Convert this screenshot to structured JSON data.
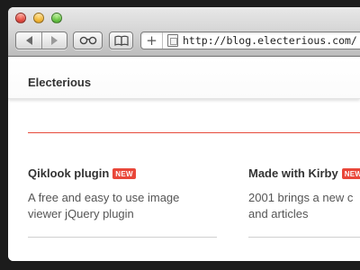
{
  "browser": {
    "url": "http://blog.electerious.com/",
    "new_tab_symbol": "+"
  },
  "site": {
    "title": "Electerious"
  },
  "posts": [
    {
      "title": "Qiklook plugin",
      "badge": "NEW",
      "description_line1": "A free and easy to use image",
      "description_line2": "viewer jQuery plugin"
    },
    {
      "title": "Made with Kirby",
      "badge": "NEW",
      "description_line1": "2001 brings a new c",
      "description_line2": "and articles"
    }
  ],
  "colors": {
    "accent": "#e64a3c",
    "badge": "#e9473a"
  }
}
